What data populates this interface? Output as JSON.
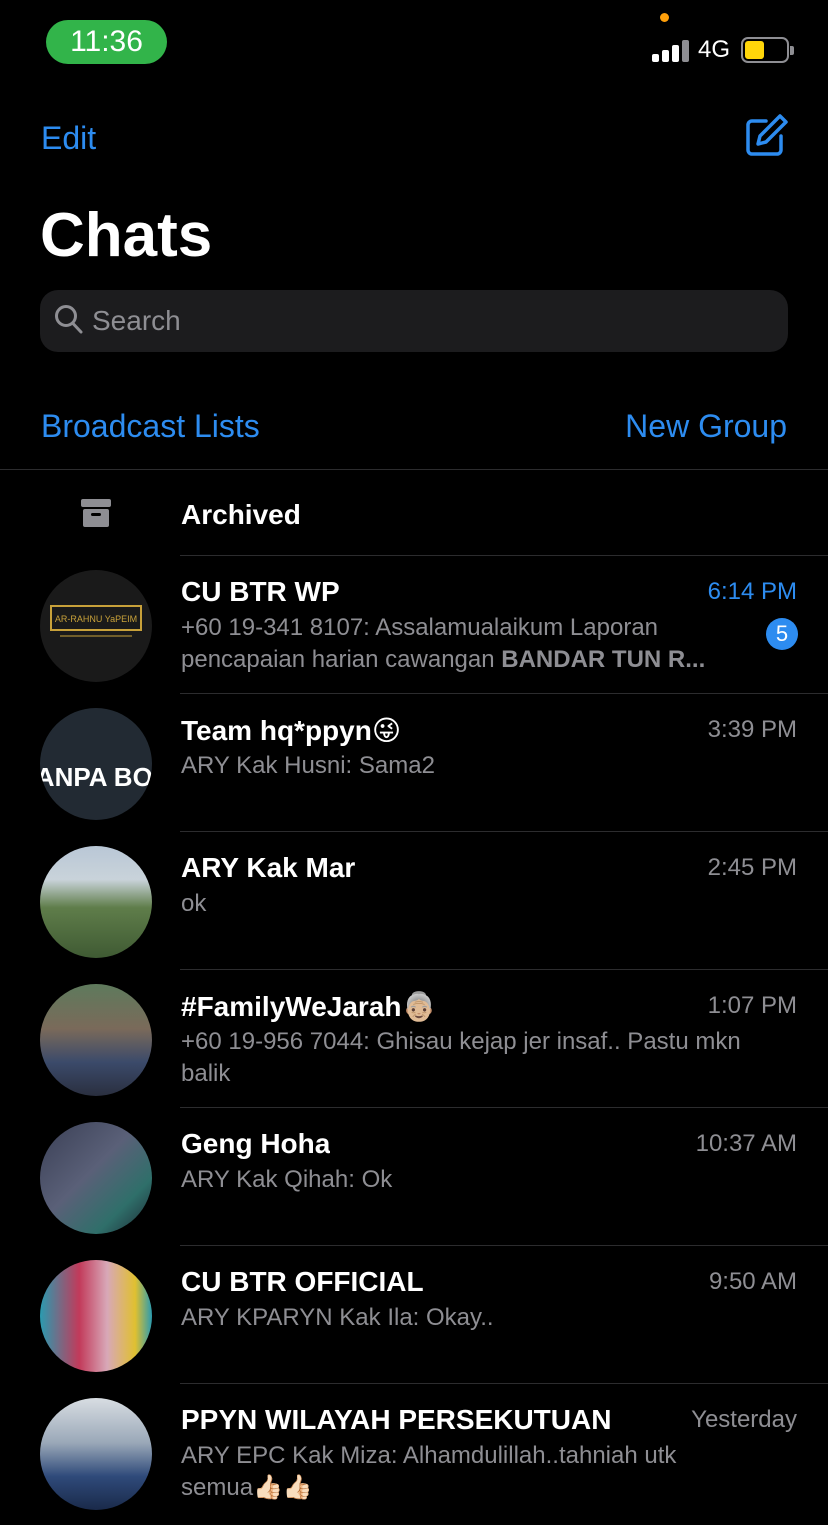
{
  "status_bar": {
    "time": "11:36",
    "network": "4G"
  },
  "nav": {
    "edit_label": "Edit",
    "title": "Chats",
    "compose_icon": "compose-icon"
  },
  "search": {
    "placeholder": "Search"
  },
  "links": {
    "broadcast": "Broadcast Lists",
    "new_group": "New Group"
  },
  "archived": {
    "label": "Archived"
  },
  "chats": [
    {
      "name": "CU BTR WP",
      "time": "6:14 PM",
      "unread": "5",
      "sender": "+60 19-341 8107: ",
      "preview": "Assalamualaikum  Laporan pencapaian harian cawangan ",
      "preview_bold": "BANDAR TUN R...",
      "avatar_text": "AR-RAHNU YaPEIM"
    },
    {
      "name": "Team hq*ppyn😜",
      "time": "3:39 PM",
      "sender": "ARY Kak Husni: ",
      "preview": "Sama2",
      "avatar_text": "TANPA BOS"
    },
    {
      "name": "ARY Kak Mar",
      "time": "2:45 PM",
      "sender": "",
      "preview": "ok"
    },
    {
      "name": "#FamilyWeJarah👵🏼",
      "time": "1:07 PM",
      "sender": "+60 19-956 7044: ",
      "preview": "Ghisau kejap jer insaf.. Pastu mkn balik"
    },
    {
      "name": "Geng Hoha",
      "time": "10:37 AM",
      "sender": "ARY Kak Qihah: ",
      "preview": "Ok"
    },
    {
      "name": "CU BTR OFFICIAL",
      "time": "9:50 AM",
      "sender": "ARY KPARYN Kak Ila: ",
      "preview": "Okay.."
    },
    {
      "name": "PPYN WILAYAH PERSEKUTUAN",
      "time": "Yesterday",
      "sender": "ARY EPC Kak Miza: ",
      "preview": "Alhamdulillah..tahniah utk semua👍🏻👍🏻"
    }
  ],
  "colors": {
    "accent": "#2d8cf0",
    "background": "#000000",
    "secondary_text": "#8e8e93",
    "time_pill": "#32b44a"
  }
}
